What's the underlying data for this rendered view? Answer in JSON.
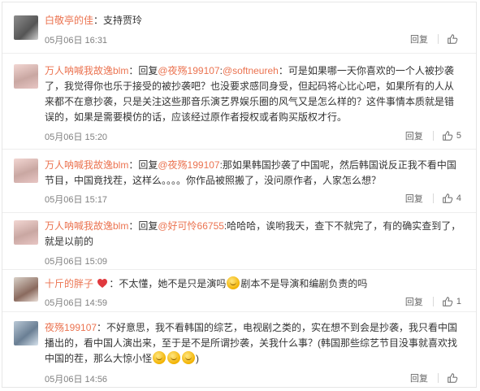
{
  "colors": {
    "accent": "#eb7350",
    "text": "#333333",
    "meta": "#808080",
    "divider": "#eeeeee"
  },
  "comments": [
    {
      "user": "白敬亭的佳",
      "text": "：支持贾玲",
      "time": "05月06日 16:31",
      "reply_label": "回复",
      "like_count": ""
    },
    {
      "user": "万人呐喊我故逸blm",
      "reply_prefix": "：回复",
      "mention": "@夜殇199107",
      "sep1": ":",
      "mention2": "@softneureh",
      "text": "：可是如果哪一天你喜欢的一个人被抄袭了，我觉得你也乐于接受的被抄袭吧？也没要求感同身受，但起码将心比心吧，如果所有的人从来都不在意抄袭，只是关注这些那音乐演艺界娱乐圈的风气又是怎么样的？这件事情本质就是错误的，如果是需要模仿的话，应该经过原作者授权或者购买版权才行。",
      "time": "05月06日 15:20",
      "reply_label": "回复",
      "like_count": "5"
    },
    {
      "user": "万人呐喊我故逸blm",
      "reply_prefix": "：回复",
      "mention": "@夜殇199107",
      "text": ":那如果韩国抄袭了中国呢，然后韩国说反正我不看中国节目，中国竟找茬，这样么。。。。你作品被照搬了，没问原作者，人家怎么想？",
      "time": "05月06日 15:17",
      "reply_label": "回复",
      "like_count": "4"
    },
    {
      "user": "万人呐喊我故逸blm",
      "reply_prefix": "：回复",
      "mention": "@好可怜66755",
      "text": ":哈哈哈，诶哟我天，查下不就完了，有的确实查到了，就是以前的",
      "time": "05月06日 15:09",
      "reply_label": "回复",
      "like_count": ""
    },
    {
      "user": "十斤的胖子",
      "text_a": "：不太懂，她不是只是演吗",
      "text_b": "剧本不是导演和编剧负责的吗",
      "time": "05月06日 14:59",
      "reply_label": "回复",
      "like_count": "1"
    },
    {
      "user": "夜殇199107",
      "text": "：不好意思，我不看韩国的综艺，电视剧之类的，实在想不到会是抄袭，我只看中国播出的，看中国人演出来，至于是不是所谓抄袭，关我什么事？(韩国那些综艺节目没事就喜欢找中国的茬，那么大惊小怪",
      "text_end": ")",
      "time": "05月06日 14:56",
      "reply_label": "回复",
      "like_count": ""
    }
  ]
}
